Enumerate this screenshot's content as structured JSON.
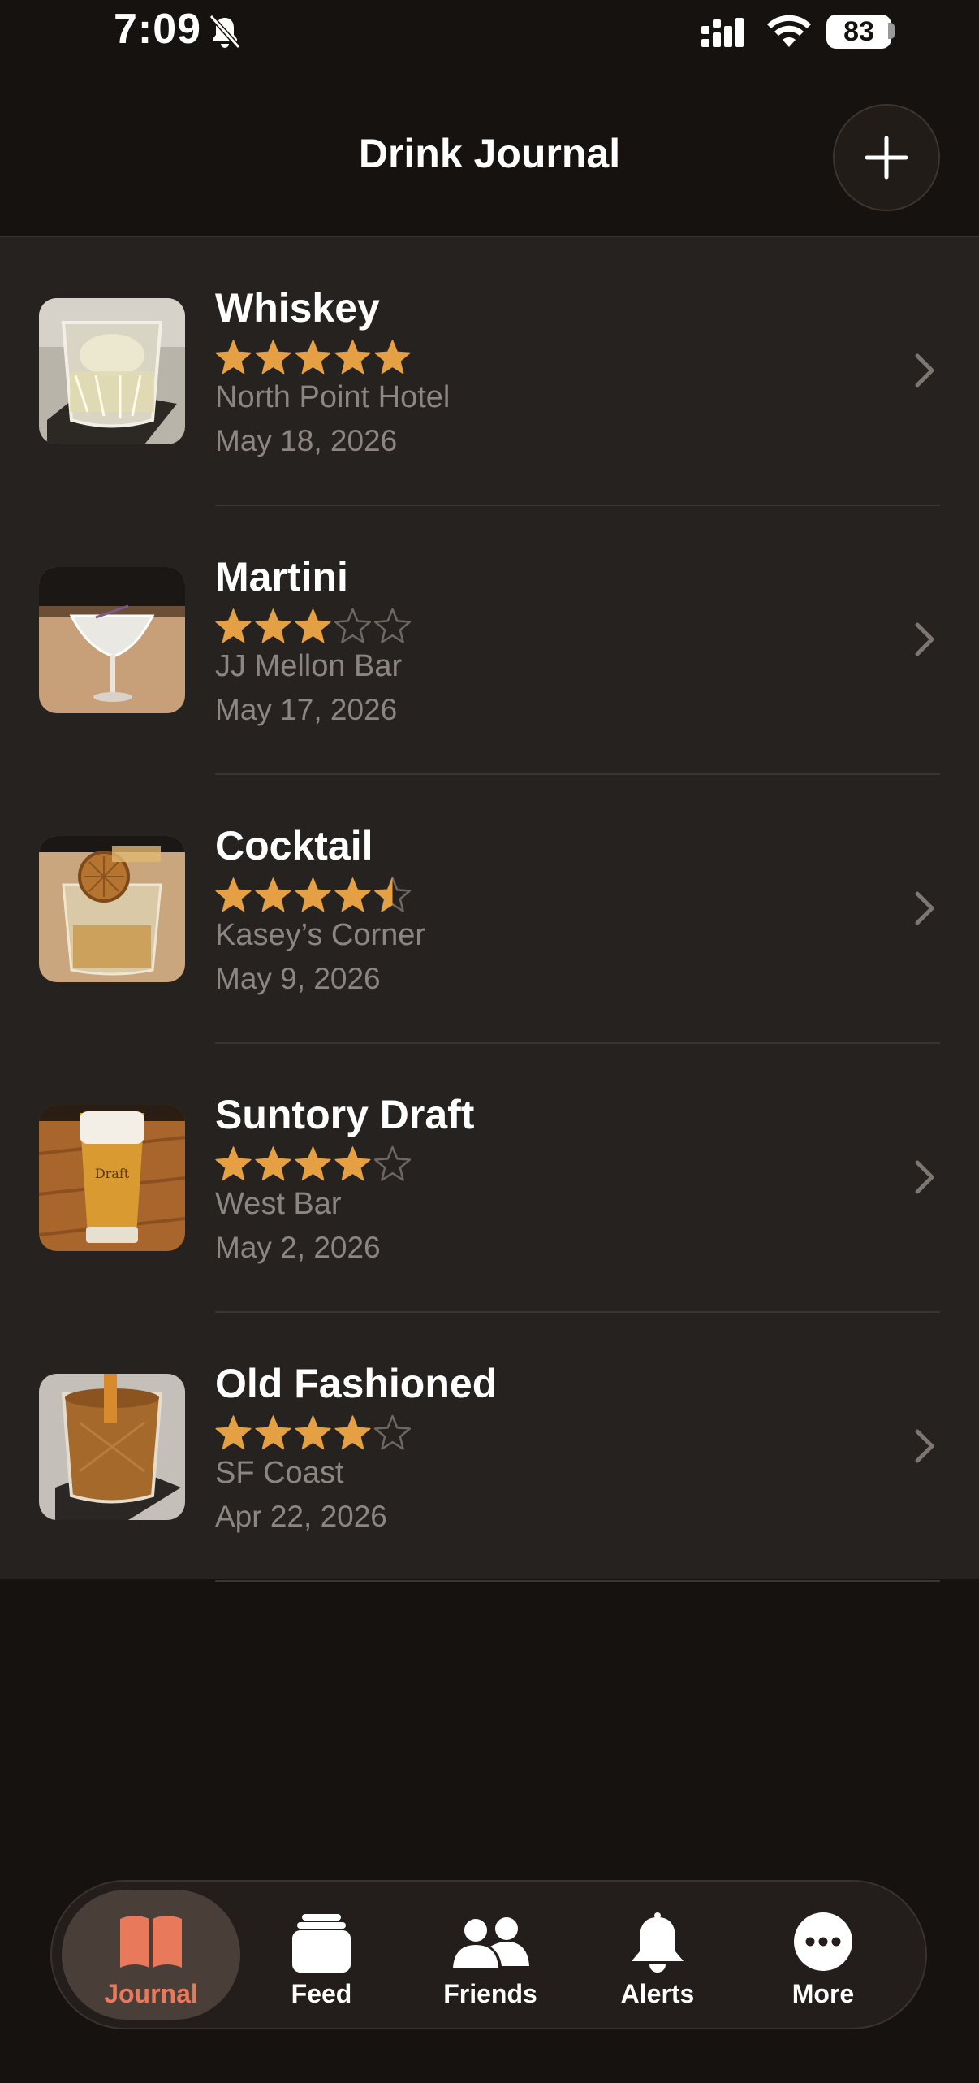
{
  "status_bar": {
    "time": "7:09",
    "battery": "83",
    "icons": [
      "bell-slash-icon",
      "cellular-signal-icon",
      "wifi-icon",
      "battery-icon"
    ]
  },
  "header": {
    "title": "Drink Journal",
    "add_icon": "plus-icon"
  },
  "theme": {
    "background": "#16120f",
    "list_background": "#252220",
    "star_color": "#e5a043",
    "accent": "#e8795a",
    "secondary_text": "#8c8681"
  },
  "entries": [
    {
      "name": "Whiskey",
      "rating": 5,
      "venue": "North Point Hotel",
      "date": "May 18, 2026",
      "photo": "whiskey-glass-photo"
    },
    {
      "name": "Martini",
      "rating": 3,
      "venue": "JJ Mellon Bar",
      "date": "May 17, 2026",
      "photo": "martini-glass-photo"
    },
    {
      "name": "Cocktail",
      "rating": 4.5,
      "venue": "Kasey’s Corner",
      "date": "May 9, 2026",
      "photo": "cocktail-glass-photo"
    },
    {
      "name": "Suntory Draft",
      "rating": 4,
      "venue": "West Bar",
      "date": "May 2, 2026",
      "photo": "beer-glass-photo"
    },
    {
      "name": "Old Fashioned",
      "rating": 4,
      "venue": "SF Coast",
      "date": "Apr 22, 2026",
      "photo": "old-fashioned-glass-photo"
    }
  ],
  "tab_bar": {
    "active": "Journal",
    "tabs": [
      {
        "label": "Journal",
        "icon": "book-icon"
      },
      {
        "label": "Feed",
        "icon": "stack-icon"
      },
      {
        "label": "Friends",
        "icon": "people-icon"
      },
      {
        "label": "Alerts",
        "icon": "bell-icon"
      },
      {
        "label": "More",
        "icon": "ellipsis-icon"
      }
    ]
  }
}
